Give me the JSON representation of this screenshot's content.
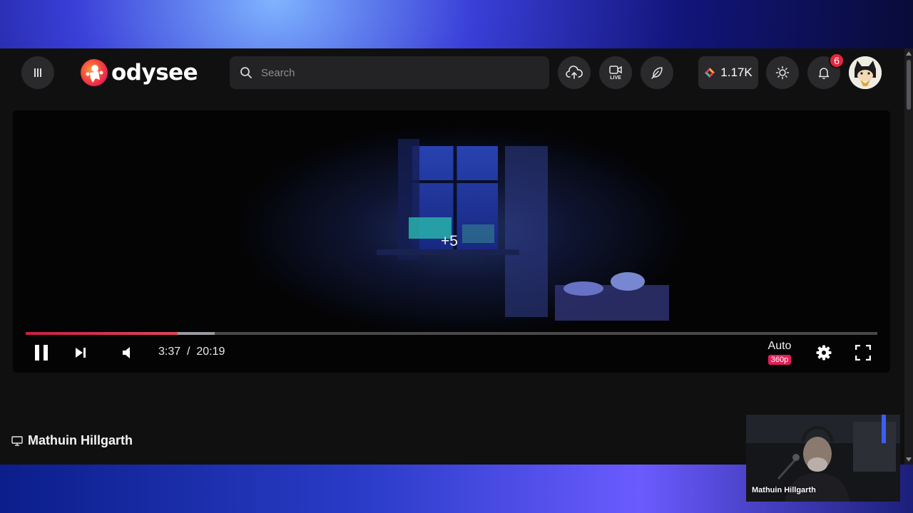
{
  "header": {
    "menu_icon": "hamburger-icon",
    "logo_text": "odysee",
    "search": {
      "placeholder": "Search",
      "value": ""
    },
    "upload_icon": "cloud-upload-icon",
    "live_label": "LIVE",
    "publish_icon": "feather-icon",
    "credits": "1.17K",
    "theme_icon": "sun-icon",
    "notifications_count": "6",
    "avatar_icon": "user-avatar"
  },
  "player": {
    "seek_indicator": "+5",
    "current_time": "3:37",
    "separator": "/",
    "duration": "20:19",
    "progress_fraction": 0.178,
    "buffered_fraction": 0.222,
    "quality_label": "Auto",
    "quality_resolution": "360p"
  },
  "channel": {
    "icon": "monitor-icon",
    "name": "Mathuin Hillgarth"
  },
  "webcam": {
    "label": "Mathuin Hillgarth"
  },
  "colors": {
    "accent": "#e31f59",
    "badge": "#e5263f",
    "header_bg": "#101011",
    "button_bg": "#2a2a2d"
  }
}
